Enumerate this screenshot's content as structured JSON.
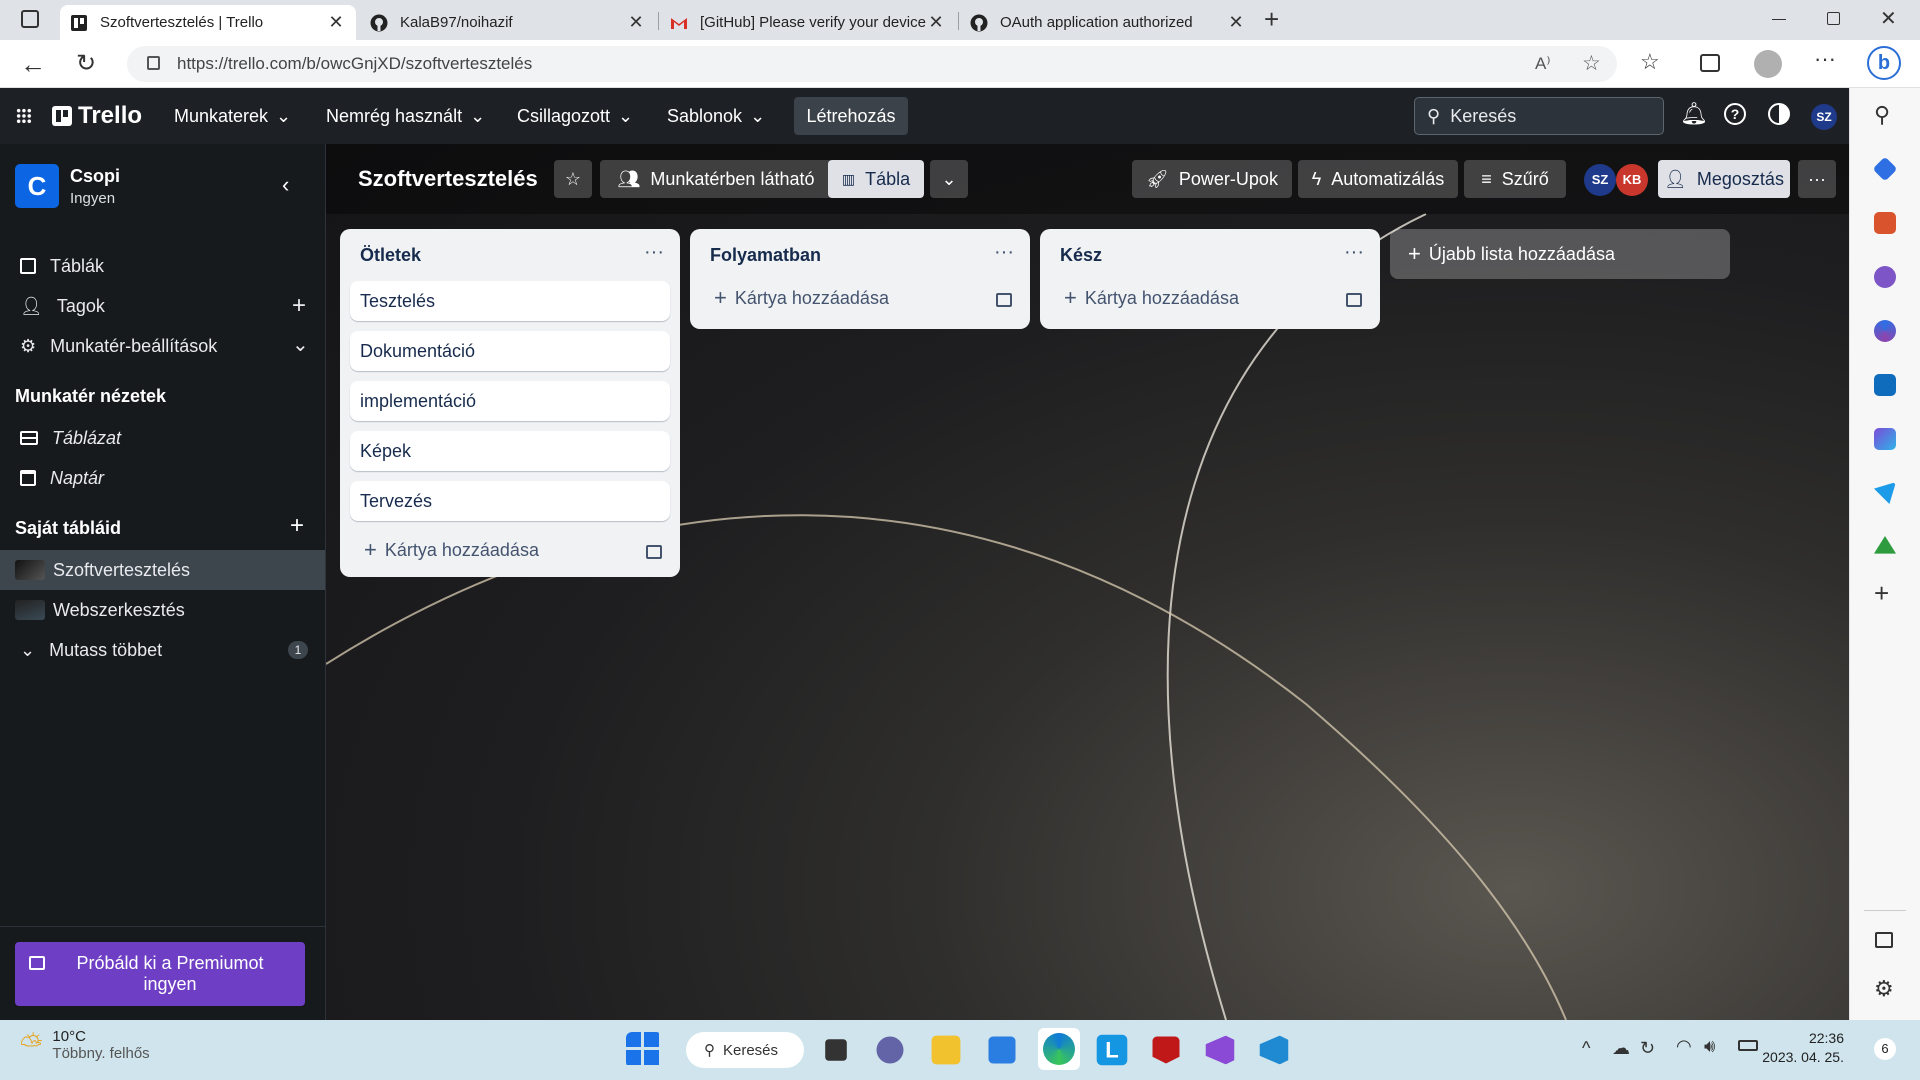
{
  "browser": {
    "tabs": [
      {
        "title": "Szoftvertesztelés | Trello",
        "icon": "trello-icon",
        "active": true
      },
      {
        "title": "KalaB97/noihazif",
        "icon": "github-icon",
        "active": false
      },
      {
        "title": "[GitHub] Please verify your device",
        "icon": "gmail-icon",
        "active": false
      },
      {
        "title": "OAuth application authorized",
        "icon": "github-icon",
        "active": false
      }
    ],
    "url": "https://trello.com/b/owcGnjXD/szoftvertesztelés",
    "reader_label": "A⁾"
  },
  "trello_header": {
    "logo_text": "Trello",
    "menus": [
      "Munkaterek",
      "Nemrég használt",
      "Csillagozott",
      "Sablonok"
    ],
    "create_label": "Létrehozás",
    "search_placeholder": "Keresés",
    "avatar_initials": "SZ"
  },
  "sidebar": {
    "workspace_initial": "C",
    "workspace_name": "Csopi",
    "workspace_plan": "Ingyen",
    "items": [
      "Táblák",
      "Tagok",
      "Munkatér-beállítások"
    ],
    "views_heading": "Munkatér nézetek",
    "views": [
      "Táblázat",
      "Naptár"
    ],
    "boards_heading": "Saját tábláid",
    "boards": [
      "Szoftvertesztelés",
      "Webszerkesztés"
    ],
    "show_more_label": "Mutass többet",
    "show_more_count": "1",
    "premium_label": "Próbáld ki a Premiumot ingyen"
  },
  "board": {
    "title": "Szoftvertesztelés",
    "visibility_label": "Munkatérben látható",
    "view_label": "Tábla",
    "powerups_label": "Power-Upok",
    "automation_label": "Automatizálás",
    "filter_label": "Szűrő",
    "members": [
      "SZ",
      "KB"
    ],
    "share_label": "Megosztás",
    "add_list_label": "Újabb lista hozzáadása",
    "lists": [
      {
        "title": "Ötletek",
        "cards": [
          "Tesztelés",
          "Dokumentáció",
          "implementáció",
          "Képek",
          "Tervezés"
        ],
        "add_card_label": "Kártya hozzáadása"
      },
      {
        "title": "Folyamatban",
        "cards": [],
        "add_card_label": "Kártya hozzáadása"
      },
      {
        "title": "Kész",
        "cards": [],
        "add_card_label": "Kártya hozzáadása"
      }
    ]
  },
  "taskbar": {
    "weather_temp": "10°C",
    "weather_desc": "Többny. felhős",
    "search_label": "Keresés",
    "time": "22:36",
    "date": "2023. 04. 25.",
    "notification_count": "6"
  },
  "colors": {
    "trello_header": "#1d2125",
    "sidebar_bg": "#161a1d",
    "workspace_tile": "#0c66e4",
    "premium": "#6e3fc4",
    "avatar_sz": "#1f3a8a",
    "avatar_kb": "#c9372c"
  }
}
